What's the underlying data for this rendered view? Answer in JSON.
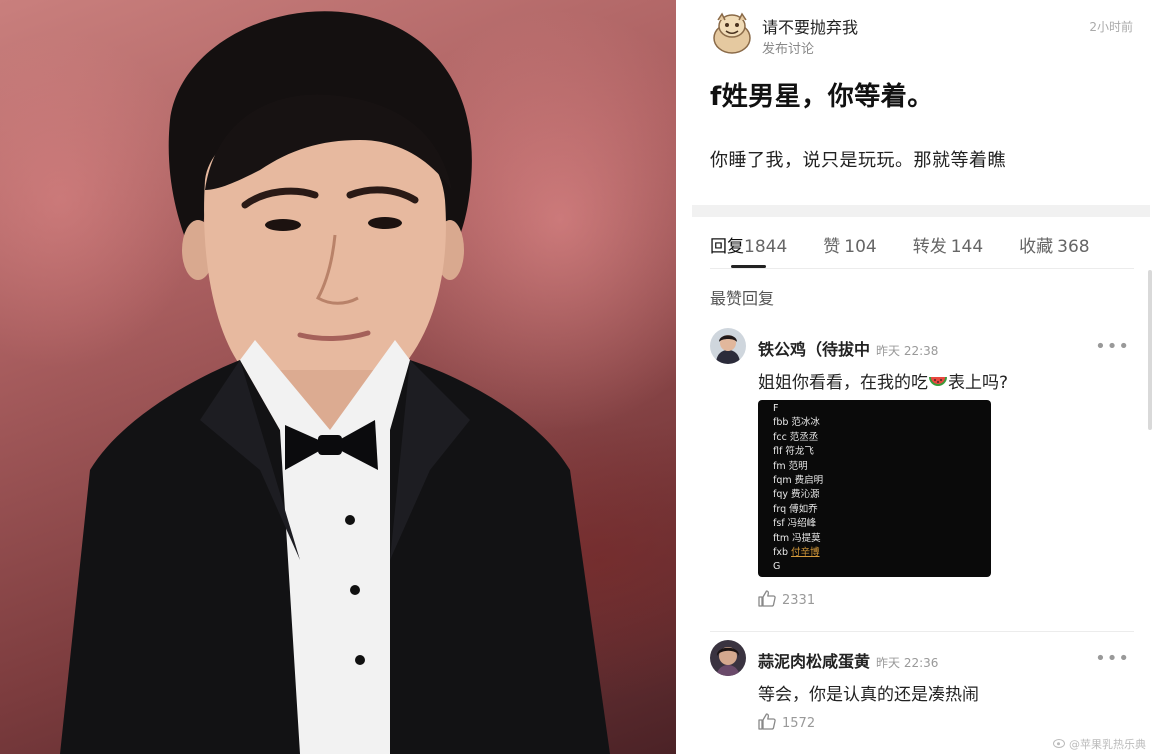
{
  "post": {
    "username": "请不要抛弃我",
    "action": "发布讨论",
    "time": "2小时前",
    "title": "f姓男星，你等着。",
    "body": "你睡了我，说只是玩玩。那就等着瞧"
  },
  "tabs": [
    {
      "label": "回复",
      "count": "1844"
    },
    {
      "label": "赞",
      "count": "104"
    },
    {
      "label": "转发",
      "count": "144"
    },
    {
      "label": "收藏",
      "count": "368"
    }
  ],
  "section_title": "最赞回复",
  "comments": [
    {
      "name": "铁公鸡（待拔中",
      "time": "昨天 22:38",
      "text_before": "姐姐你看看，在我的吃",
      "text_after": "表上吗?",
      "likes": "2331",
      "screenshot_lines": [
        {
          "text": "F"
        },
        {
          "text": "fbb 范冰冰"
        },
        {
          "text": "fcc 范丞丞"
        },
        {
          "text": "flf 符龙飞"
        },
        {
          "text": "fm 范明"
        },
        {
          "text": "fqm 费启明"
        },
        {
          "text": "fqy 费沁源"
        },
        {
          "text": "frq 傅如乔"
        },
        {
          "text": "fsf 冯绍峰"
        },
        {
          "text": "ftm 冯提莫"
        },
        {
          "prefix": "fxb ",
          "link": "付辛博"
        },
        {
          "text": "G"
        }
      ]
    },
    {
      "name": "蒜泥肉松咸蛋黄",
      "time": "昨天 22:36",
      "text": "等会，你是认真的还是凑热闹",
      "likes": "1572"
    }
  ],
  "more_label": "•••",
  "watermark": "@苹果乳热乐典",
  "colors": {
    "link": "#d69a3a",
    "muted": "#999999",
    "background_photo": "#a95e5f"
  }
}
